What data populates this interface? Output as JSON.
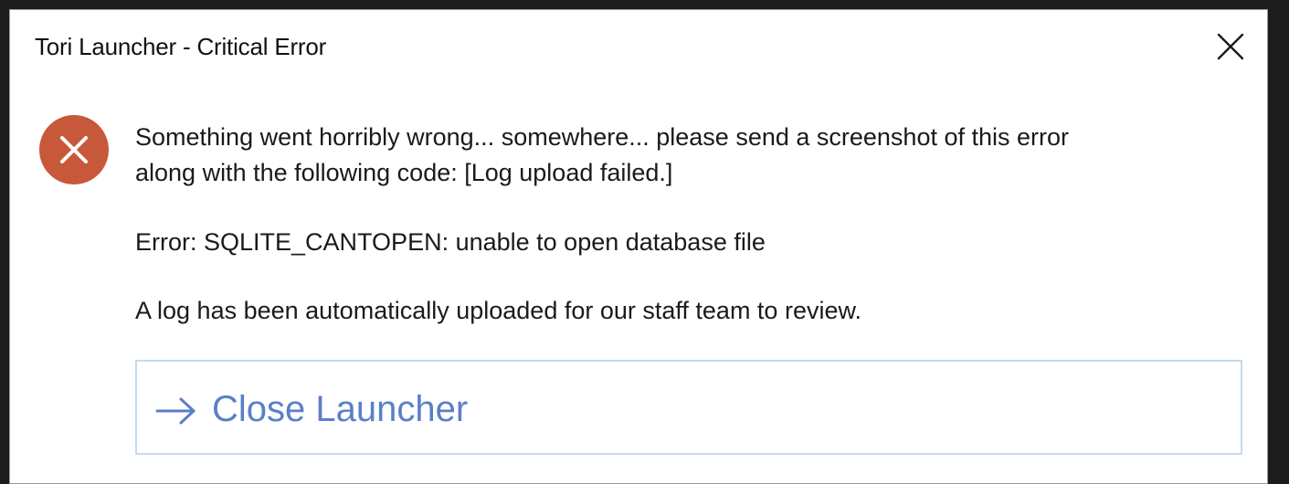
{
  "window": {
    "title": "Tori Launcher - Critical Error",
    "close_icon": "close-icon"
  },
  "dialog": {
    "icon": "error-icon",
    "icon_color": "#c8583a",
    "message_line1": "Something went horribly wrong... somewhere... please send a screenshot of this error",
    "message_line2": "along with the following code: [Log upload failed.]",
    "error_text": "Error: SQLITE_CANTOPEN: unable to open database file",
    "log_text": "A log has been automatically uploaded for our staff team to review."
  },
  "actions": {
    "close_launcher_label": "Close Launcher",
    "close_launcher_icon": "arrow-right-icon",
    "accent_color": "#5b7fc7"
  }
}
